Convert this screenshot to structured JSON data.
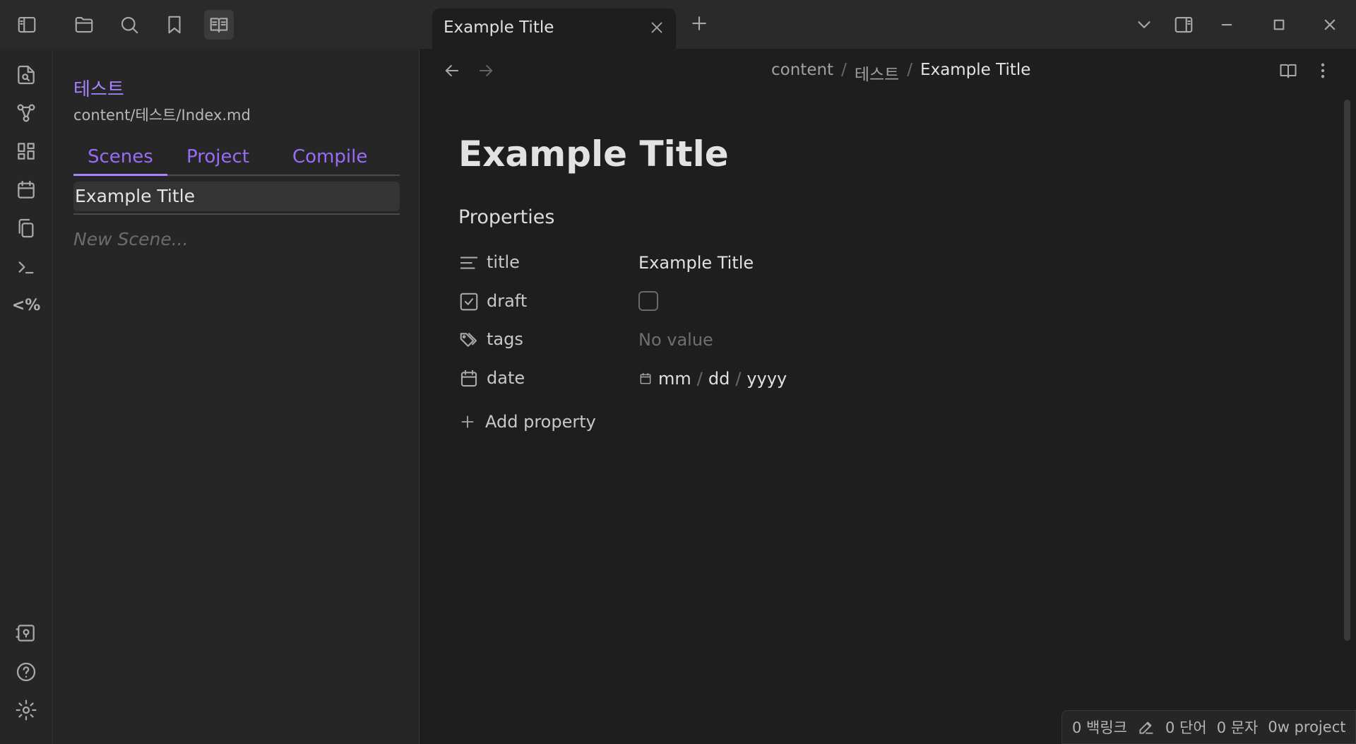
{
  "titlebar": {
    "icons": [
      "sidebar-toggle-icon",
      "folder-icon",
      "search-icon",
      "bookmark-icon",
      "book-icon"
    ],
    "tab": {
      "title": "Example Title"
    },
    "right_icons": [
      "chevron-down-icon",
      "right-sidebar-icon",
      "minimize-icon",
      "maximize-icon",
      "close-icon"
    ]
  },
  "ribbon": {
    "icons": [
      "file-search-icon",
      "graph-icon",
      "dashboard-icon",
      "calendar-icon",
      "copy-icon",
      "terminal-icon",
      "templater-icon",
      "vault-icon",
      "help-icon",
      "settings-icon"
    ],
    "templater_label": "<%"
  },
  "sidebar": {
    "project_name": "테스트",
    "project_path": "content/테스트/Index.md",
    "tabs": [
      {
        "label": "Scenes",
        "active": true
      },
      {
        "label": "Project",
        "active": false
      },
      {
        "label": "Compile",
        "active": false
      }
    ],
    "scenes": [
      "Example Title"
    ],
    "new_scene_placeholder": "New Scene..."
  },
  "main": {
    "breadcrumb": {
      "parts": [
        "content",
        "테스트"
      ],
      "separator": "/",
      "current": "Example Title"
    },
    "title": "Example Title",
    "properties_heading": "Properties",
    "properties": {
      "title": {
        "key": "title",
        "value": "Example Title"
      },
      "draft": {
        "key": "draft",
        "value": false
      },
      "tags": {
        "key": "tags",
        "value": "No value"
      },
      "date": {
        "key": "date",
        "mm": "mm",
        "dd": "dd",
        "yyyy": "yyyy",
        "separator": "/"
      }
    },
    "add_property_label": "Add property"
  },
  "statusbar": {
    "backlinks": "0 백링크",
    "words": "0 단어",
    "chars": "0 문자",
    "project": "0w project"
  },
  "colors": {
    "accent": "#a882ff",
    "background": "#1e1e1e",
    "sidebar": "#262626",
    "titlebar": "#2a2a2a"
  }
}
